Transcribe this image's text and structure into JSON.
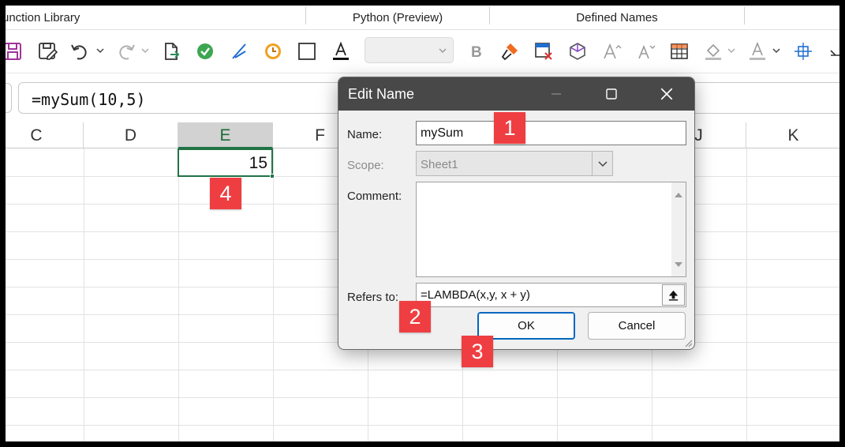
{
  "ribbon": {
    "groups": [
      {
        "label": "unction Library"
      },
      {
        "label": "Python (Preview)"
      },
      {
        "label": "Defined Names"
      }
    ]
  },
  "formula_bar": {
    "formula": "=mySum(10,5)"
  },
  "sheet": {
    "columns": [
      "C",
      "D",
      "E",
      "F",
      "J",
      "K"
    ],
    "selected_column": "E",
    "active_cell_value": "15"
  },
  "dialog": {
    "title": "Edit Name",
    "name_label": "Name:",
    "name_value": "mySum",
    "scope_label": "Scope:",
    "scope_value": "Sheet1",
    "comment_label": "Comment:",
    "comment_value": "",
    "refers_label": "Refers to:",
    "refers_value": "=LAMBDA(x,y, x + y)",
    "ok_label": "OK",
    "cancel_label": "Cancel"
  },
  "badges": {
    "step1": "1",
    "step2": "2",
    "step3": "3",
    "step4": "4"
  },
  "colors": {
    "badge": "#ef3e42",
    "selection_green": "#217346",
    "dialog_titlebar": "#484848",
    "ok_border": "#0067c0"
  },
  "icons": [
    "save-icon",
    "save-as-icon",
    "undo-icon",
    "redo-icon",
    "document-arrow-icon",
    "check-circle-icon",
    "pen-icon",
    "clock-icon",
    "rectangle-icon",
    "font-color-icon",
    "bold-icon",
    "format-painter-icon",
    "clear-format-icon",
    "cube-icon",
    "increase-font-icon",
    "decrease-font-icon",
    "borders-icon",
    "fill-color-icon",
    "text-color-icon",
    "move-icon"
  ]
}
